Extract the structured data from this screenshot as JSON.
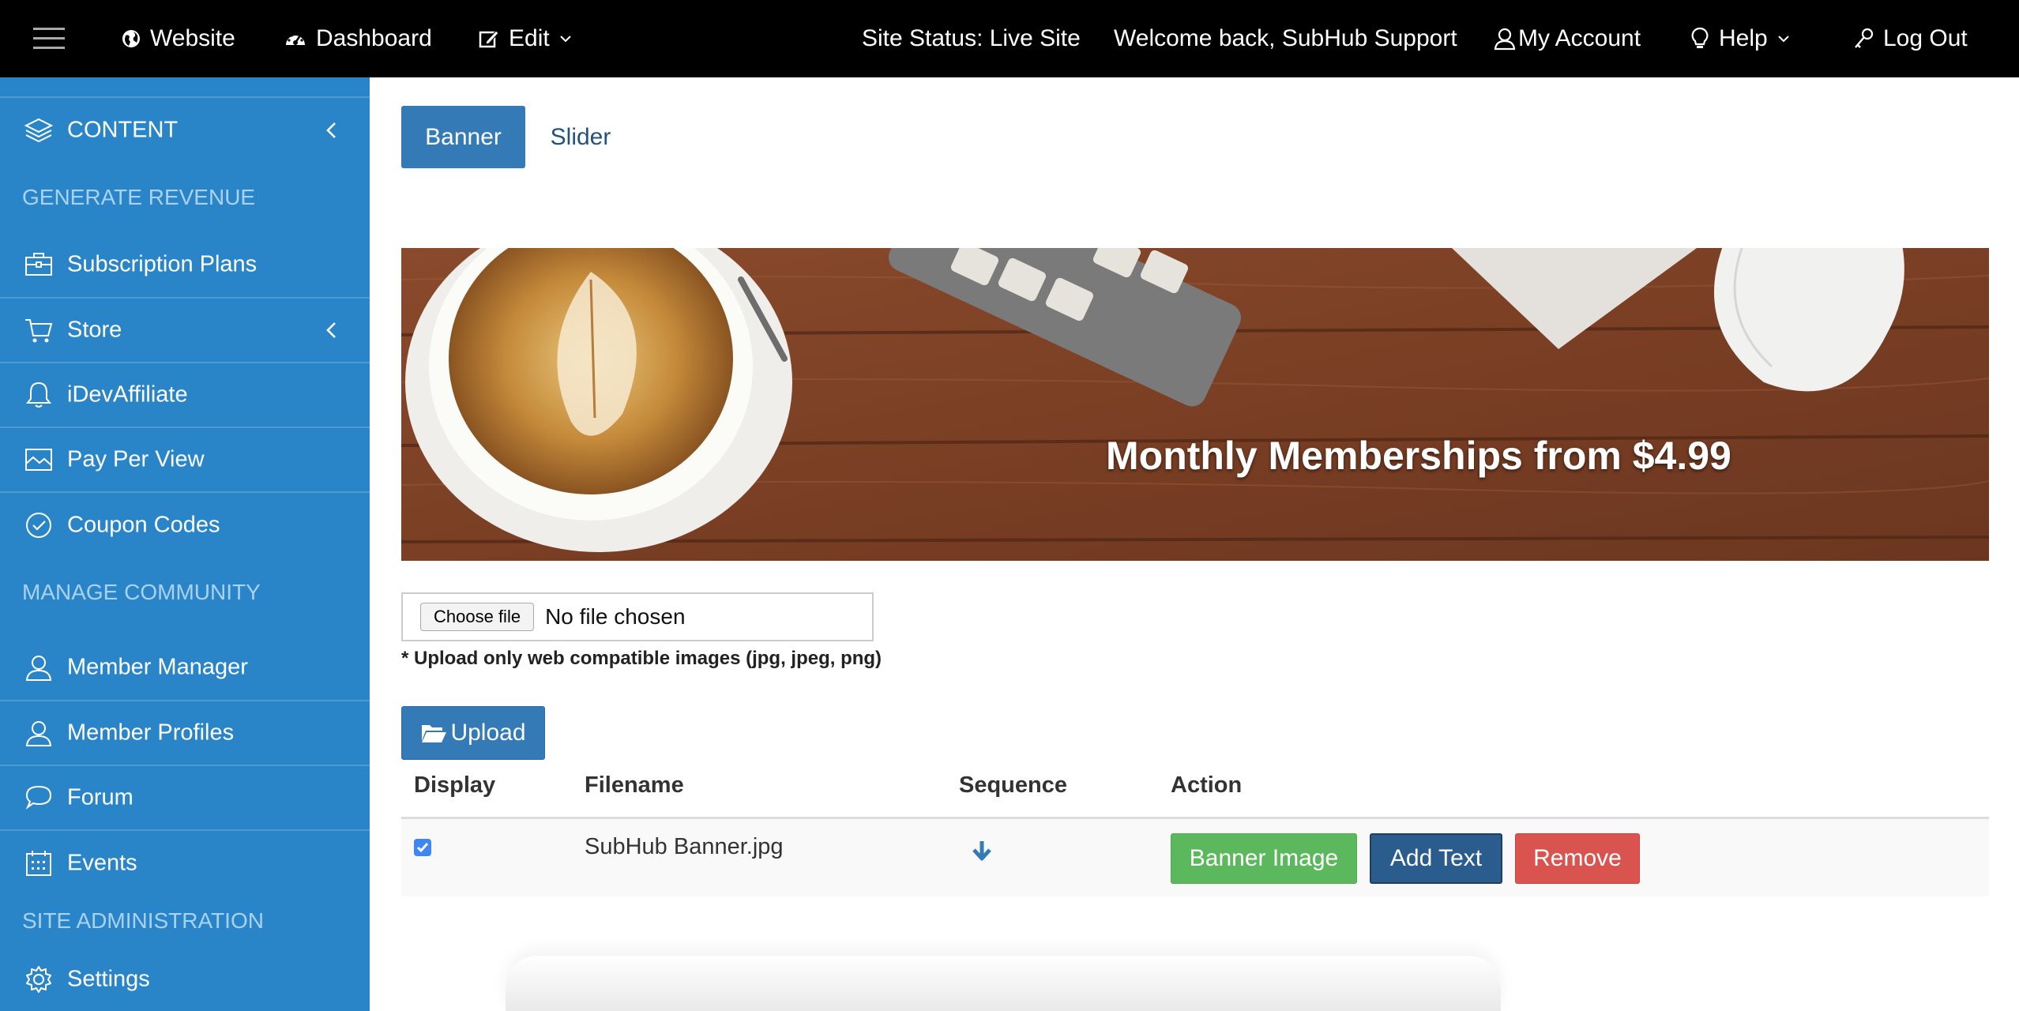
{
  "topbar": {
    "items": [
      {
        "label": "Website",
        "icon": "globe-icon"
      },
      {
        "label": "Dashboard",
        "icon": "dashboard-icon"
      },
      {
        "label": "Edit",
        "icon": "edit-icon"
      },
      {
        "label": "Site Status: Live Site"
      },
      {
        "label": "Welcome back, SubHub Support"
      },
      {
        "label": "My Account",
        "icon": "user-icon"
      },
      {
        "label": "Help",
        "icon": "lightbulb-icon"
      },
      {
        "label": "Log Out",
        "icon": "key-icon"
      }
    ]
  },
  "sidebar": {
    "content": "CONTENT",
    "sections": [
      "GENERATE REVENUE",
      "MANAGE COMMUNITY",
      "SITE ADMINISTRATION"
    ],
    "items": [
      {
        "label": "Subscription Plans"
      },
      {
        "label": "Store"
      },
      {
        "label": "iDevAffiliate"
      },
      {
        "label": "Pay Per View"
      },
      {
        "label": "Coupon Codes"
      },
      {
        "label": "Member Manager"
      },
      {
        "label": "Member Profiles"
      },
      {
        "label": "Forum"
      },
      {
        "label": "Events"
      },
      {
        "label": "Settings"
      }
    ]
  },
  "tabs": [
    "Banner",
    "Slider"
  ],
  "banner": {
    "text": "Monthly Memberships from $4.99"
  },
  "file_input": {
    "button": "Choose file",
    "status": "No file chosen"
  },
  "hint": "* Upload only web compatible images (jpg, jpeg, png)",
  "upload_label": "Upload",
  "table": {
    "headers": [
      "Display",
      "Filename",
      "Sequence",
      "Action"
    ],
    "rows": [
      {
        "display": true,
        "filename": "SubHub Banner.jpg",
        "actions": [
          "Banner Image",
          "Add Text",
          "Remove"
        ]
      }
    ]
  },
  "colors": {
    "topbar": "#000000",
    "sidebar": "#2a85c8",
    "primary": "#337ab7",
    "success": "#5cb85c",
    "navy": "#2b5c8e",
    "danger": "#d9534f"
  }
}
